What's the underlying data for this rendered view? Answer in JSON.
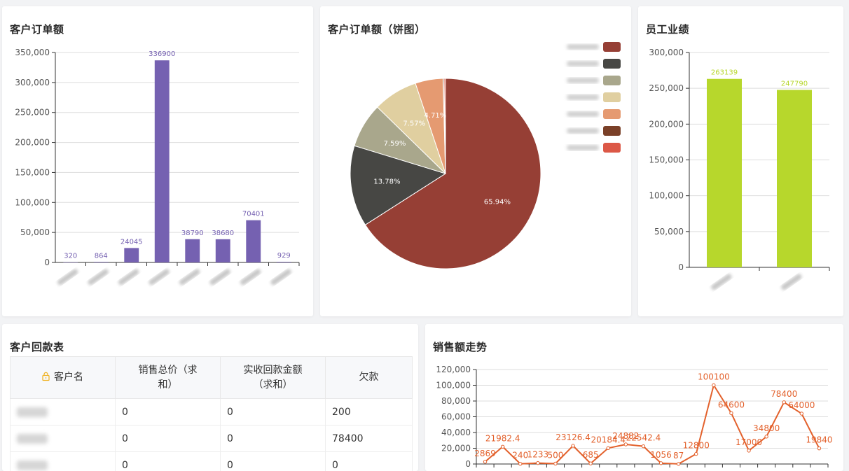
{
  "cards": {
    "customer_orders": {
      "title": "客户订单额"
    },
    "customer_orders_pie": {
      "title": "客户订单额（饼图）"
    },
    "staff_performance": {
      "title": "员工业绩"
    },
    "customer_payments": {
      "title": "客户回款表"
    },
    "sales_trend": {
      "title": "销售额走势"
    }
  },
  "chart_data": [
    {
      "id": "customer_orders",
      "type": "bar",
      "values": [
        320,
        864,
        24045,
        336900,
        38790,
        38680,
        70401,
        929
      ],
      "ylim": [
        0,
        350000
      ],
      "yticks": [
        "0",
        "50,000",
        "100,000",
        "150,000",
        "200,000",
        "250,000",
        "300,000",
        "350,000"
      ],
      "color": "#7561b1"
    },
    {
      "id": "customer_orders_pie",
      "type": "pie",
      "slices": [
        {
          "pct": 65.94,
          "label": "65.94%",
          "color": "#963f35"
        },
        {
          "pct": 13.78,
          "label": "13.78%",
          "color": "#474744"
        },
        {
          "pct": 7.59,
          "label": "7.59%",
          "color": "#a9a78c"
        },
        {
          "pct": 7.57,
          "label": "7.57%",
          "color": "#e0cfa0"
        },
        {
          "pct": 4.71,
          "label": "4.71%",
          "color": "#e59a71"
        },
        {
          "pct": 0.17,
          "label": "",
          "color": "#7a4028"
        },
        {
          "pct": 0.24,
          "label": "",
          "color": "#dc5846"
        }
      ]
    },
    {
      "id": "staff_performance",
      "type": "bar",
      "values": [
        263139,
        247790
      ],
      "ylim": [
        0,
        300000
      ],
      "yticks": [
        "0",
        "50,000",
        "100,000",
        "150,000",
        "200,000",
        "250,000",
        "300,000"
      ],
      "color": "#b7d72c"
    },
    {
      "id": "sales_trend",
      "type": "line",
      "values": [
        2869,
        21982.4,
        240,
        1233,
        500,
        23126.4,
        685,
        20184.4,
        24882,
        22542.4,
        1056,
        87,
        12800,
        100100,
        64600,
        17000,
        34800,
        78400,
        64000,
        19840
      ],
      "labels": [
        "2869",
        "21982.4",
        "240",
        "1233",
        "500",
        "23126.4",
        "685",
        "20184.4",
        "24882",
        "22542.4",
        "1056",
        "87",
        "12800",
        "100100",
        "64600",
        "17000",
        "34800",
        "78400",
        "64000",
        "19840"
      ],
      "ylim": [
        0,
        120000
      ],
      "yticks": [
        "0",
        "20,000",
        "40,000",
        "60,000",
        "80,000",
        "100,000",
        "120,000"
      ],
      "color": "#e3612c"
    }
  ],
  "payments_table": {
    "headers": [
      "客户名",
      "销售总价（求和）",
      "实收回款金额（求和）",
      "欠款"
    ],
    "header_lines": [
      [
        "客户名"
      ],
      [
        "销售总价（求",
        "和）"
      ],
      [
        "实收回款金额",
        "（求和）"
      ],
      [
        "欠款"
      ]
    ],
    "rows": [
      [
        "0",
        "0",
        "200"
      ],
      [
        "0",
        "0",
        "78400"
      ],
      [
        "0",
        "0",
        "0"
      ]
    ]
  }
}
